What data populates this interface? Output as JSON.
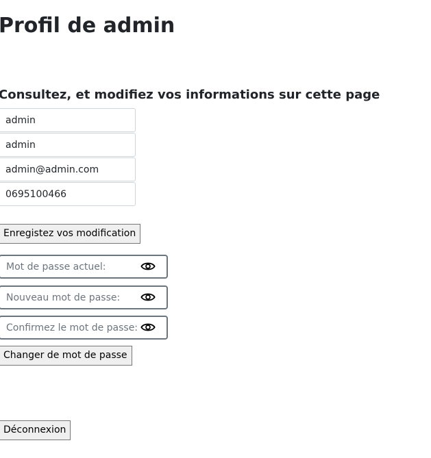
{
  "header": {
    "title": "Profil de admin"
  },
  "profile": {
    "subtitle": "Consultez, et modifiez vos informations sur cette page",
    "fields": {
      "first_name": "admin",
      "last_name": "admin",
      "email": "admin@admin.com",
      "phone": "0695100466"
    },
    "save_label": "Enregistez vos modification"
  },
  "password": {
    "current_placeholder": "Mot de passe actuel:",
    "new_placeholder": "Nouveau mot de passe:",
    "confirm_placeholder": "Confirmez le mot de passe:",
    "change_label": "Changer de mot de passe",
    "toggle_icon": "eye-icon"
  },
  "logout_label": "Déconnexion"
}
